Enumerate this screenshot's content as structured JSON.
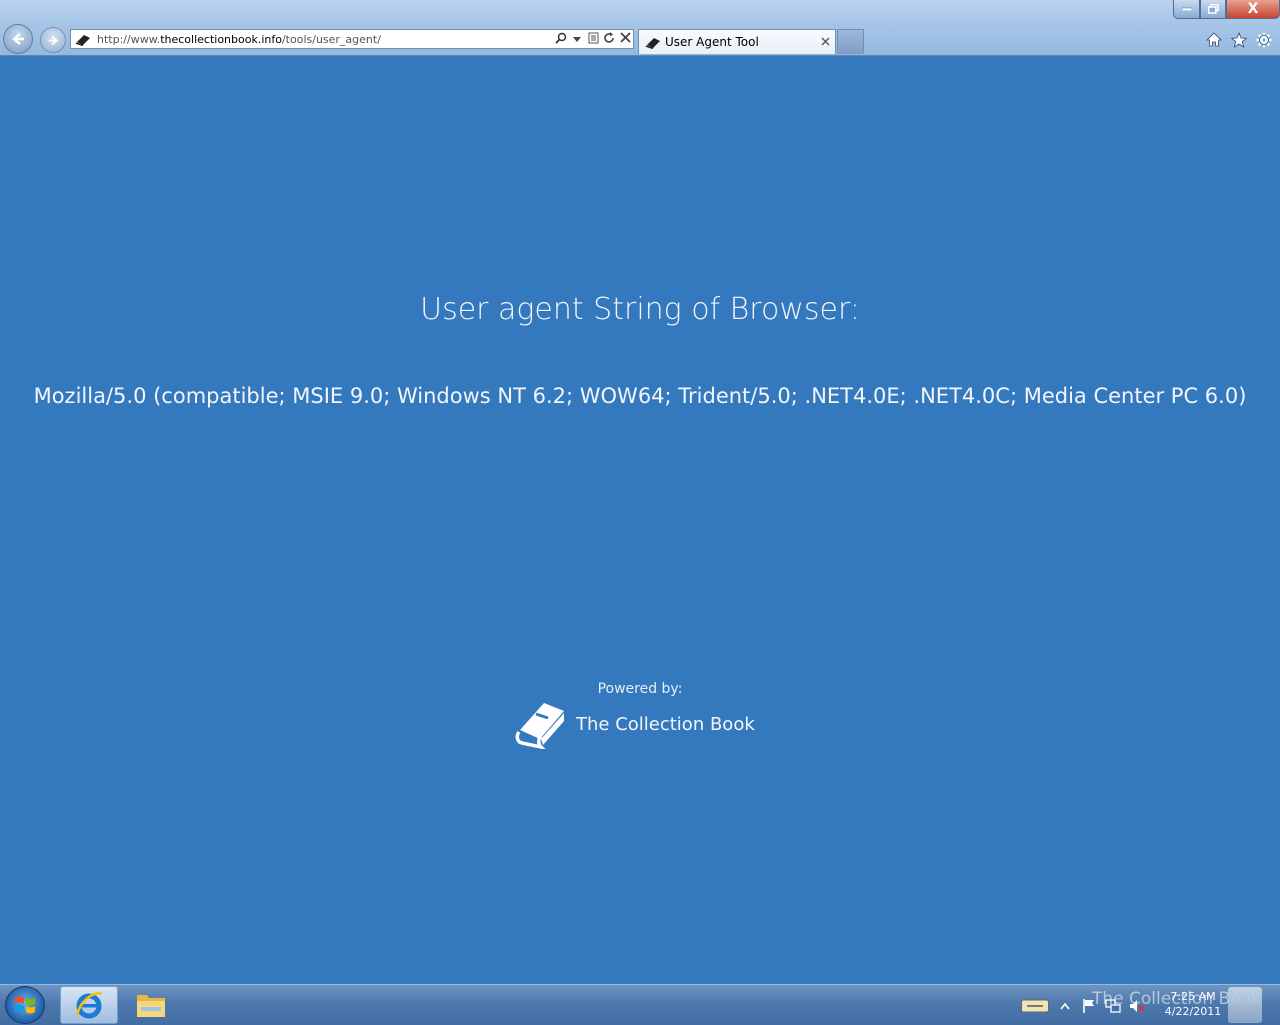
{
  "browser": {
    "address_bar": {
      "url_prefix": "http://www.",
      "url_domain": "thecollectionbook.info",
      "url_path": "/tools/user_agent/"
    },
    "tab": {
      "label": "User Agent Tool"
    },
    "window_controls": {
      "minimize_icon": "minimize-icon",
      "maximize_icon": "restore-icon",
      "close_label": "X"
    }
  },
  "page": {
    "heading": "User agent String of Browser:",
    "user_agent": "Mozilla/5.0 (compatible; MSIE 9.0; Windows NT 6.2; WOW64; Trident/5.0; .NET4.0E; .NET4.0C; Media Center PC 6.0)",
    "powered_by_label": "Powered by:",
    "brand_name": "The Collection Book"
  },
  "taskbar": {
    "clock_time": "7:25 AM",
    "clock_date": "4/22/2011",
    "watermark": "The Collection Book"
  }
}
